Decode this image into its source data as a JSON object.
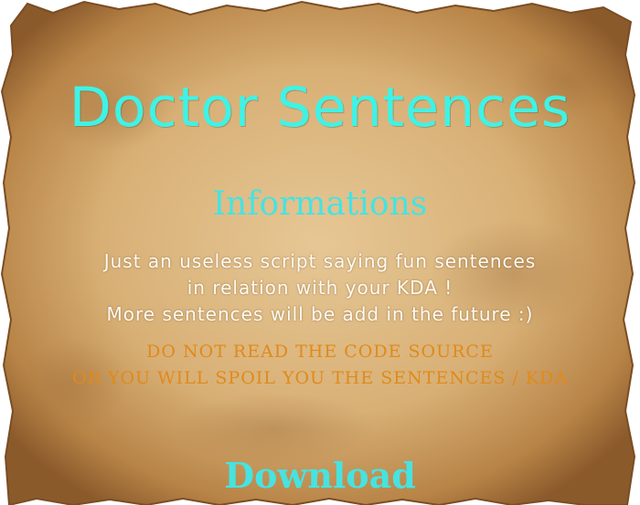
{
  "title": "Doctor Sentences",
  "subtitle": "Informations",
  "description_lines": [
    "Just an useless script saying fun sentences",
    "in relation with your KDA !",
    "More sentences will be add in the future :)"
  ],
  "warning_lines": [
    "DO NOT READ THE CODE SOURCE",
    "OR YOU WILL SPOIL YOU THE SENTENCES / KDA"
  ],
  "download_label": "Download",
  "colors": {
    "title": "#3ef3e6",
    "subtitle": "#46e3e1",
    "description": "#fffaf0",
    "warning": "#e08a1a",
    "download": "#46e3e1",
    "parchment": "#d9b47c"
  }
}
